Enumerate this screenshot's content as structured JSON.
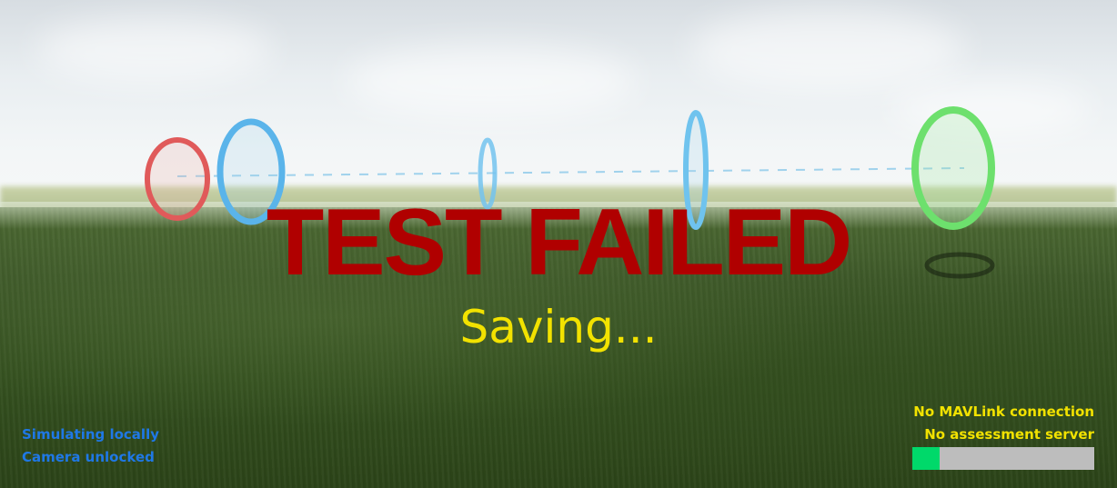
{
  "overlay": {
    "title": "TEST FAILED",
    "status": "Saving..."
  },
  "hud_left": {
    "simulation_mode": "Simulating locally",
    "camera_state": "Camera unlocked"
  },
  "hud_right": {
    "mavlink_status": "No MAVLink connection",
    "assessment_status": "No assessment server",
    "progress_fraction": 0.15
  },
  "colors": {
    "title": "#b00000",
    "status": "#f2e200",
    "hud_left_text": "#1f78e6",
    "hud_right_text": "#f2e200",
    "progress_fill": "#00d96a",
    "progress_track": "#bdbdbd",
    "ring_red": "#e05a5a",
    "ring_blue": "#5ab4ea",
    "ring_green": "#6de06d"
  }
}
